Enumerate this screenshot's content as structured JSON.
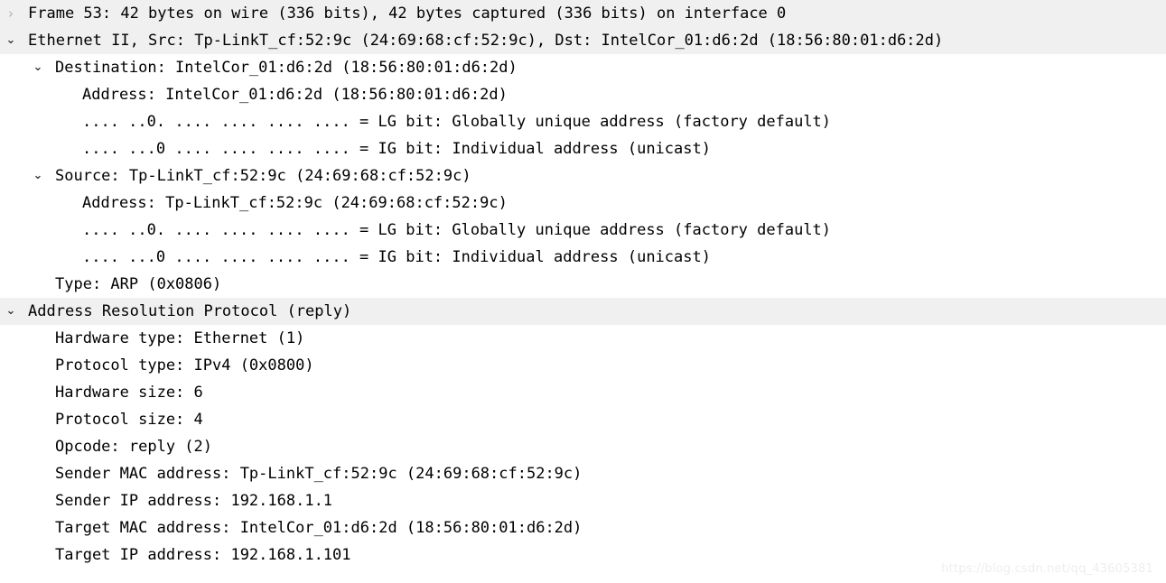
{
  "pane": {
    "name": "packet-details",
    "background_color": "#ffffff",
    "highlight_color": "#f0f0f0",
    "text_color": "#000000"
  },
  "icons": {
    "collapsed": "›",
    "expanded": "⌄"
  },
  "rows": [
    {
      "id": "frame",
      "depth": 0,
      "twisty": "collapsed",
      "highlighted": true,
      "text": "Frame 53: 42 bytes on wire (336 bits), 42 bytes captured (336 bits) on interface 0"
    },
    {
      "id": "ethernet",
      "depth": 0,
      "twisty": "expanded",
      "highlighted": true,
      "text": "Ethernet II, Src: Tp-LinkT_cf:52:9c (24:69:68:cf:52:9c), Dst: IntelCor_01:d6:2d (18:56:80:01:d6:2d)"
    },
    {
      "id": "destination",
      "depth": 1,
      "twisty": "expanded",
      "highlighted": false,
      "text": "Destination: IntelCor_01:d6:2d (18:56:80:01:d6:2d)"
    },
    {
      "id": "destination-address",
      "depth": 2,
      "twisty": "none",
      "highlighted": false,
      "text": "Address: IntelCor_01:d6:2d (18:56:80:01:d6:2d)"
    },
    {
      "id": "destination-lg-bit",
      "depth": 2,
      "twisty": "none",
      "highlighted": false,
      "text": ".... ..0. .... .... .... .... = LG bit: Globally unique address (factory default)"
    },
    {
      "id": "destination-ig-bit",
      "depth": 2,
      "twisty": "none",
      "highlighted": false,
      "text": ".... ...0 .... .... .... .... = IG bit: Individual address (unicast)"
    },
    {
      "id": "source",
      "depth": 1,
      "twisty": "expanded",
      "highlighted": false,
      "text": "Source: Tp-LinkT_cf:52:9c (24:69:68:cf:52:9c)"
    },
    {
      "id": "source-address",
      "depth": 2,
      "twisty": "none",
      "highlighted": false,
      "text": "Address: Tp-LinkT_cf:52:9c (24:69:68:cf:52:9c)"
    },
    {
      "id": "source-lg-bit",
      "depth": 2,
      "twisty": "none",
      "highlighted": false,
      "text": ".... ..0. .... .... .... .... = LG bit: Globally unique address (factory default)"
    },
    {
      "id": "source-ig-bit",
      "depth": 2,
      "twisty": "none",
      "highlighted": false,
      "text": ".... ...0 .... .... .... .... = IG bit: Individual address (unicast)"
    },
    {
      "id": "ethertype",
      "depth": 1,
      "twisty": "none",
      "highlighted": false,
      "text": "Type: ARP (0x0806)"
    },
    {
      "id": "arp",
      "depth": 0,
      "twisty": "expanded",
      "highlighted": true,
      "text": "Address Resolution Protocol (reply)"
    },
    {
      "id": "arp-hardware-type",
      "depth": 1,
      "twisty": "none",
      "highlighted": false,
      "text": "Hardware type: Ethernet (1)"
    },
    {
      "id": "arp-protocol-type",
      "depth": 1,
      "twisty": "none",
      "highlighted": false,
      "text": "Protocol type: IPv4 (0x0800)"
    },
    {
      "id": "arp-hardware-size",
      "depth": 1,
      "twisty": "none",
      "highlighted": false,
      "text": "Hardware size: 6"
    },
    {
      "id": "arp-protocol-size",
      "depth": 1,
      "twisty": "none",
      "highlighted": false,
      "text": "Protocol size: 4"
    },
    {
      "id": "arp-opcode",
      "depth": 1,
      "twisty": "none",
      "highlighted": false,
      "text": "Opcode: reply (2)"
    },
    {
      "id": "arp-sender-mac",
      "depth": 1,
      "twisty": "none",
      "highlighted": false,
      "text": "Sender MAC address: Tp-LinkT_cf:52:9c (24:69:68:cf:52:9c)"
    },
    {
      "id": "arp-sender-ip",
      "depth": 1,
      "twisty": "none",
      "highlighted": false,
      "text": "Sender IP address: 192.168.1.1"
    },
    {
      "id": "arp-target-mac",
      "depth": 1,
      "twisty": "none",
      "highlighted": false,
      "text": "Target MAC address: IntelCor_01:d6:2d (18:56:80:01:d6:2d)"
    },
    {
      "id": "arp-target-ip",
      "depth": 1,
      "twisty": "none",
      "highlighted": false,
      "text": "Target IP address: 192.168.1.101"
    }
  ],
  "watermark": {
    "text": "https://blog.csdn.net/qq_43605381"
  }
}
